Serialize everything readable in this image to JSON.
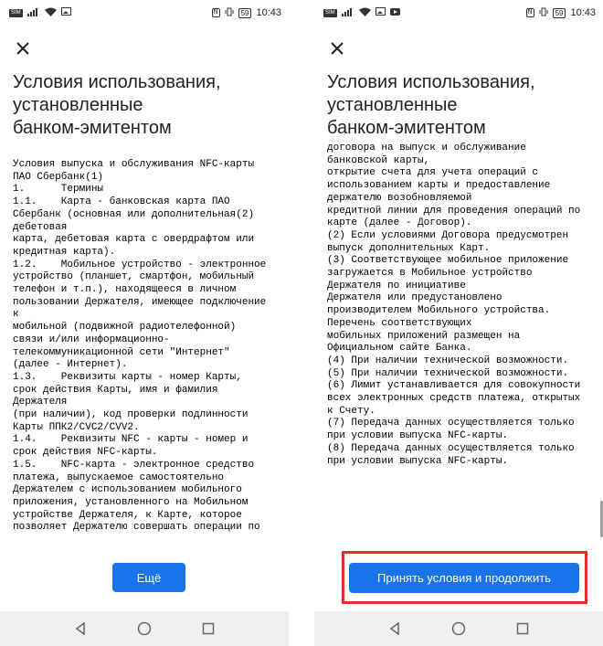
{
  "status_bar": {
    "battery": "59",
    "time": "10:43",
    "sim_icon": "sim-icon",
    "signal_icon": "signal-icon",
    "wifi_icon": "wifi-icon",
    "image_icon": "image-icon",
    "nfc_icon": "nfc-icon",
    "vibrate_icon": "vibrate-icon",
    "battery_icon": "battery-icon"
  },
  "left": {
    "title": "Условия использования,\nустановленные\nбанком-эмитентом",
    "terms_text": "Условия выпуска и обслуживания NFC-карты\nПАО Сбербанк(1)\n1.      Термины\n1.1.    Карта - банковская карта ПАО\nСбербанк (основная или дополнительная(2)\nдебетовая\nкарта, дебетовая карта с овердрафтом или\nкредитная карта).\n1.2.    Мобильное устройство - электронное\nустройство (планшет, смартфон, мобильный\nтелефон и т.п.), находящееся в личном\nпользовании Держателя, имеющее подключение\nк\nмобильной (подвижной радиотелефонной)\nсвязи и/или информационно-\nтелекоммуникационной сети \"Интернет\"\n(далее - Интернет).\n1.3.    Реквизиты карты - номер Карты,\nсрок действия Карты, имя и фамилия\nДержателя\n(при наличии), код проверки подлинности\nКарты ППК2/CVC2/CVV2.\n1.4.    Реквизиты NFC - карты - номер и\nсрок действия NFC-карты.\n1.5.    NFC-карта - электронное средство\nплатежа, выпускаемое самостоятельно\nДержателем с использованием мобильного\nприложения, установленного на Мобильном\nустройстве Держателя, к Карте, которое\nпозволяет Держателю совершать операции по",
    "next_button": "Ещё"
  },
  "right": {
    "title": "Условия использования,\nустановленные\nбанком-эмитентом",
    "terms_text": "договора на выпуск и обслуживание\nбанковской карты,\nоткрытие счета для учета операций с\nиспользованием карты и предоставление\nдержателю возобновляемой\nкредитной линии для проведения операций по\nкарте (далее - Договор).\n(2) Если условиями Договора предусмотрен\nвыпуск дополнительных Карт.\n(3) Соответствующее мобильное приложение\nзагружается в Мобильное устройство\nДержателя по инициативе\nДержателя или предустановлено\nпроизводителем Мобильного устройства.\nПеречень соответствующих\nмобильных приложений размещен на\nОфициальном сайте Банка.\n(4) При наличии технической возможности.\n(5) При наличии технической возможности.\n(6) Лимит устанавливается для совокупности\nвсех электронных средств платежа, открытых\nк Счету.\n(7) Передача данных осуществляется только\nпри условии выпуска NFC-карты.\n(8) Передача данных осуществляется только\nпри условии выпуска NFC-карты.",
    "accept_button": "Принять условия и продолжить"
  },
  "icons": {
    "close": "close-icon",
    "back": "back-triangle-icon",
    "home": "home-circle-icon",
    "recents": "recents-square-icon"
  },
  "colors": {
    "button_blue": "#1a73e8",
    "highlight_red": "#e52b2b",
    "nav_bg": "#f0f0f0"
  }
}
